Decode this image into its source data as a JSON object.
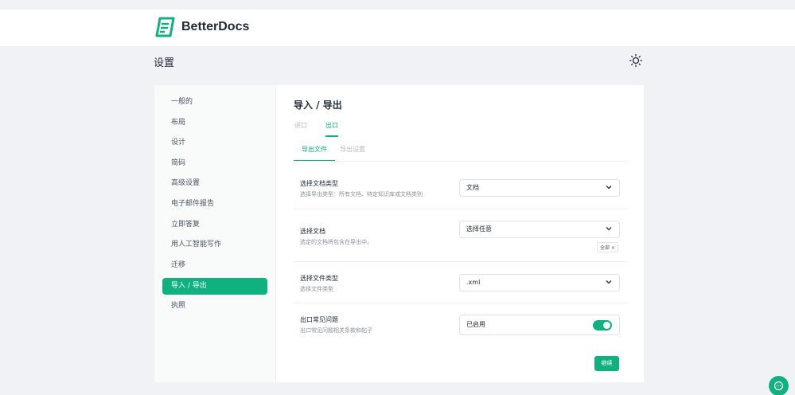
{
  "brand": {
    "name": "BetterDocs"
  },
  "header": {
    "title": "设置",
    "theme_icon": "sun-icon"
  },
  "sidebar": {
    "items": [
      {
        "label": "一般的",
        "active": false
      },
      {
        "label": "布局",
        "active": false
      },
      {
        "label": "设计",
        "active": false
      },
      {
        "label": "简码",
        "active": false
      },
      {
        "label": "高级设置",
        "active": false
      },
      {
        "label": "电子邮件报告",
        "active": false
      },
      {
        "label": "立即答复",
        "active": false
      },
      {
        "label": "用人工智能写作",
        "active": false
      },
      {
        "label": "迁移",
        "active": false
      },
      {
        "label": "导入 / 导出",
        "active": true
      },
      {
        "label": "执照",
        "active": false
      }
    ]
  },
  "main": {
    "title": "导入 / 导出",
    "tabs": [
      {
        "label": "进口",
        "active": false
      },
      {
        "label": "出口",
        "active": true
      }
    ],
    "subtabs": [
      {
        "label": "导出文件",
        "active": true
      },
      {
        "label": "导出设置",
        "active": false
      }
    ],
    "rows": [
      {
        "label": "选择文档类型",
        "desc": "选择导出类型：所有文档、特定知识库或文档类别",
        "value": "文档"
      },
      {
        "label": "选择文档",
        "desc": "选定的文档将包含在导出中。",
        "value": "选择任意",
        "chip": "全部 ×"
      },
      {
        "label": "选择文件类型",
        "desc": "选择文件类型",
        "value": ".xml"
      },
      {
        "label": "出口常见问题",
        "desc": "出口常见问题相关条款和帖子",
        "value": "已启用",
        "toggle_on": true
      }
    ],
    "continue_label": "继续"
  },
  "colors": {
    "accent": "#0fb17e",
    "background": "#f1f2f5"
  }
}
